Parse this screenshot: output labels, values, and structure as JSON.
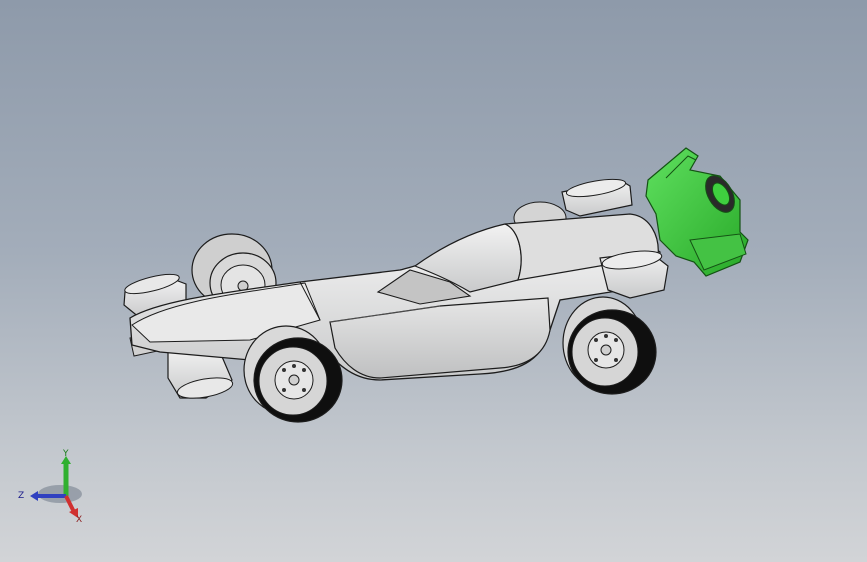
{
  "viewport": {
    "background_top": "#8e9aaa",
    "background_bottom": "#d2d4d7"
  },
  "model": {
    "body_color": "#dadbdc",
    "edge_color": "#1c1c1c",
    "tire_color": "#111111",
    "selected_part_color": "#3fcf3f"
  },
  "triad": {
    "x_label": "X",
    "y_label": "Y",
    "z_label": "Z",
    "x_color": "#d03030",
    "y_color": "#30b030",
    "z_color": "#3040c0"
  }
}
